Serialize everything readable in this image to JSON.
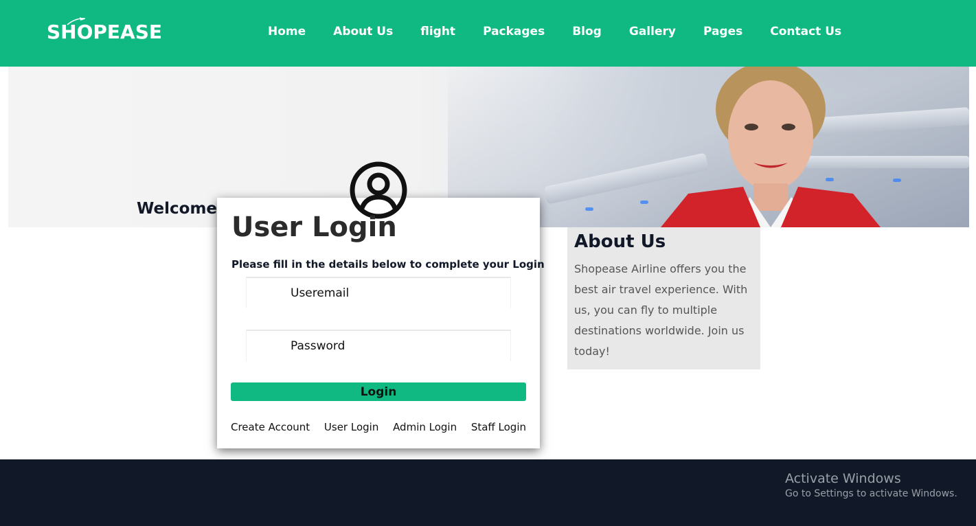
{
  "brand": {
    "logo_text": "SHOPEASE",
    "accent": "#10b981",
    "dark": "#111827"
  },
  "nav": {
    "items": [
      {
        "label": "Home"
      },
      {
        "label": "About Us"
      },
      {
        "label": "flight"
      },
      {
        "label": "Packages"
      },
      {
        "label": "Blog"
      },
      {
        "label": "Gallery"
      },
      {
        "label": "Pages"
      },
      {
        "label": "Contact Us"
      }
    ]
  },
  "hero": {
    "title": "Welcome to Shopease Airline"
  },
  "login": {
    "icon": "user-circle-icon",
    "title": "User Login",
    "subtitle": "Please fill in the details below to complete your Login",
    "email_placeholder": "Useremail",
    "password_placeholder": "Password",
    "button_label": "Login",
    "links": [
      {
        "label": "Create Account"
      },
      {
        "label": "User Login"
      },
      {
        "label": "Admin Login"
      },
      {
        "label": "Staff Login"
      }
    ]
  },
  "about": {
    "title": "About Us",
    "text": "Shopease Airline offers you the best air travel experience. With us, you can fly to multiple destinations worldwide. Join us today!"
  },
  "windows_watermark": {
    "title": "Activate Windows",
    "subtitle": "Go to Settings to activate Windows."
  }
}
